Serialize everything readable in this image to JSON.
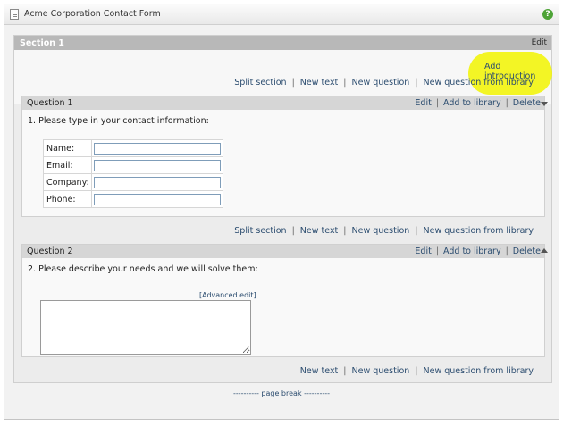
{
  "window": {
    "title": "Acme Corporation Contact Form",
    "help_glyph": "?"
  },
  "section": {
    "title": "Section 1",
    "edit_label": "Edit",
    "add_introduction": "Add introduction",
    "highlight_color": "#f2f400"
  },
  "toolbar1": {
    "split": "Split section",
    "new_text": "New text",
    "new_question": "New question",
    "new_question_library": "New question from library"
  },
  "toolbar2": {
    "split": "Split section",
    "new_text": "New text",
    "new_question": "New question",
    "new_question_library": "New question from library"
  },
  "toolbar3": {
    "new_text": "New text",
    "new_question": "New question",
    "new_question_library": "New question from library"
  },
  "question1": {
    "title": "Question 1",
    "actions": {
      "edit": "Edit",
      "add_library": "Add to library",
      "delete": "Delete"
    },
    "text": "1.  Please type in your contact information:",
    "fields": [
      "Name:",
      "Email:",
      "Company:",
      "Phone:"
    ]
  },
  "question2": {
    "title": "Question 2",
    "actions": {
      "edit": "Edit",
      "add_library": "Add to library",
      "delete": "Delete"
    },
    "text": "2.  Please describe your needs and we will solve them:",
    "advanced_edit": "[Advanced edit]"
  },
  "page_break": "---------- page break ----------",
  "separator": "|"
}
